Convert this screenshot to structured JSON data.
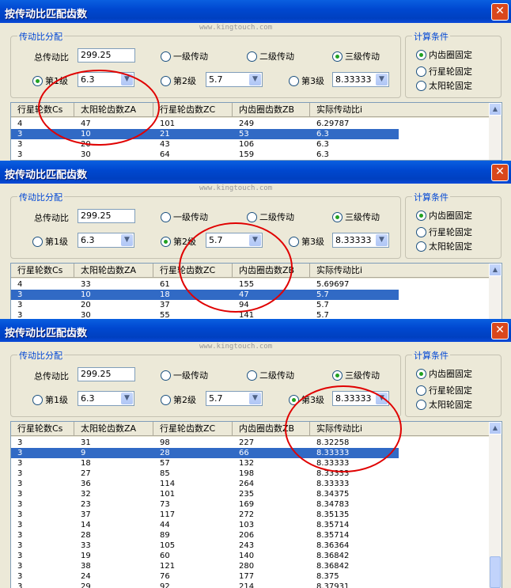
{
  "title": "按传动比匹配齿数",
  "close_symbol": "✕",
  "watermark": "www.kingtouch.com",
  "group_ratio": "传动比分配",
  "group_calc": "计算条件",
  "total_label": "总传动比",
  "total_value": "299.25",
  "stages": {
    "one": "一级传动",
    "two": "二级传动",
    "three": "三级传动"
  },
  "levels": {
    "l1": "第1级",
    "l2": "第2级",
    "l3": "第3级"
  },
  "level_values": {
    "l1": "6.3",
    "l2": "5.7",
    "l3": "8.33333"
  },
  "conditions": {
    "ring": "内齿圈固定",
    "carrier": "行星轮固定",
    "sun": "太阳轮固定"
  },
  "icons": {
    "dropdown": "▼",
    "scroll_up": "▲"
  },
  "columns": [
    "行星轮数Cs",
    "太阳轮齿数ZA",
    "行星轮齿数ZC",
    "内齿圈齿数ZB",
    "实际传动比i"
  ],
  "panels": [
    {
      "selected_level": "l1",
      "rows": [
        [
          "4",
          "47",
          "101",
          "249",
          "6.29787"
        ],
        [
          "3",
          "10",
          "21",
          "53",
          "6.3"
        ],
        [
          "3",
          "20",
          "43",
          "106",
          "6.3"
        ],
        [
          "3",
          "30",
          "64",
          "159",
          "6.3"
        ]
      ],
      "selected_row": 1
    },
    {
      "selected_level": "l2",
      "rows": [
        [
          "4",
          "33",
          "61",
          "155",
          "5.69697"
        ],
        [
          "3",
          "10",
          "18",
          "47",
          "5.7"
        ],
        [
          "3",
          "20",
          "37",
          "94",
          "5.7"
        ],
        [
          "3",
          "30",
          "55",
          "141",
          "5.7"
        ]
      ],
      "selected_row": 1
    },
    {
      "selected_level": "l3",
      "rows": [
        [
          "3",
          "31",
          "98",
          "227",
          "8.32258"
        ],
        [
          "3",
          "9",
          "28",
          "66",
          "8.33333"
        ],
        [
          "3",
          "18",
          "57",
          "132",
          "8.33333"
        ],
        [
          "3",
          "27",
          "85",
          "198",
          "8.33333"
        ],
        [
          "3",
          "36",
          "114",
          "264",
          "8.33333"
        ],
        [
          "3",
          "32",
          "101",
          "235",
          "8.34375"
        ],
        [
          "3",
          "23",
          "73",
          "169",
          "8.34783"
        ],
        [
          "3",
          "37",
          "117",
          "272",
          "8.35135"
        ],
        [
          "3",
          "14",
          "44",
          "103",
          "8.35714"
        ],
        [
          "3",
          "28",
          "89",
          "206",
          "8.35714"
        ],
        [
          "3",
          "33",
          "105",
          "243",
          "8.36364"
        ],
        [
          "3",
          "19",
          "60",
          "140",
          "8.36842"
        ],
        [
          "3",
          "38",
          "121",
          "280",
          "8.36842"
        ],
        [
          "3",
          "24",
          "76",
          "177",
          "8.375"
        ],
        [
          "3",
          "29",
          "92",
          "214",
          "8.37931"
        ]
      ],
      "selected_row": 1
    }
  ]
}
